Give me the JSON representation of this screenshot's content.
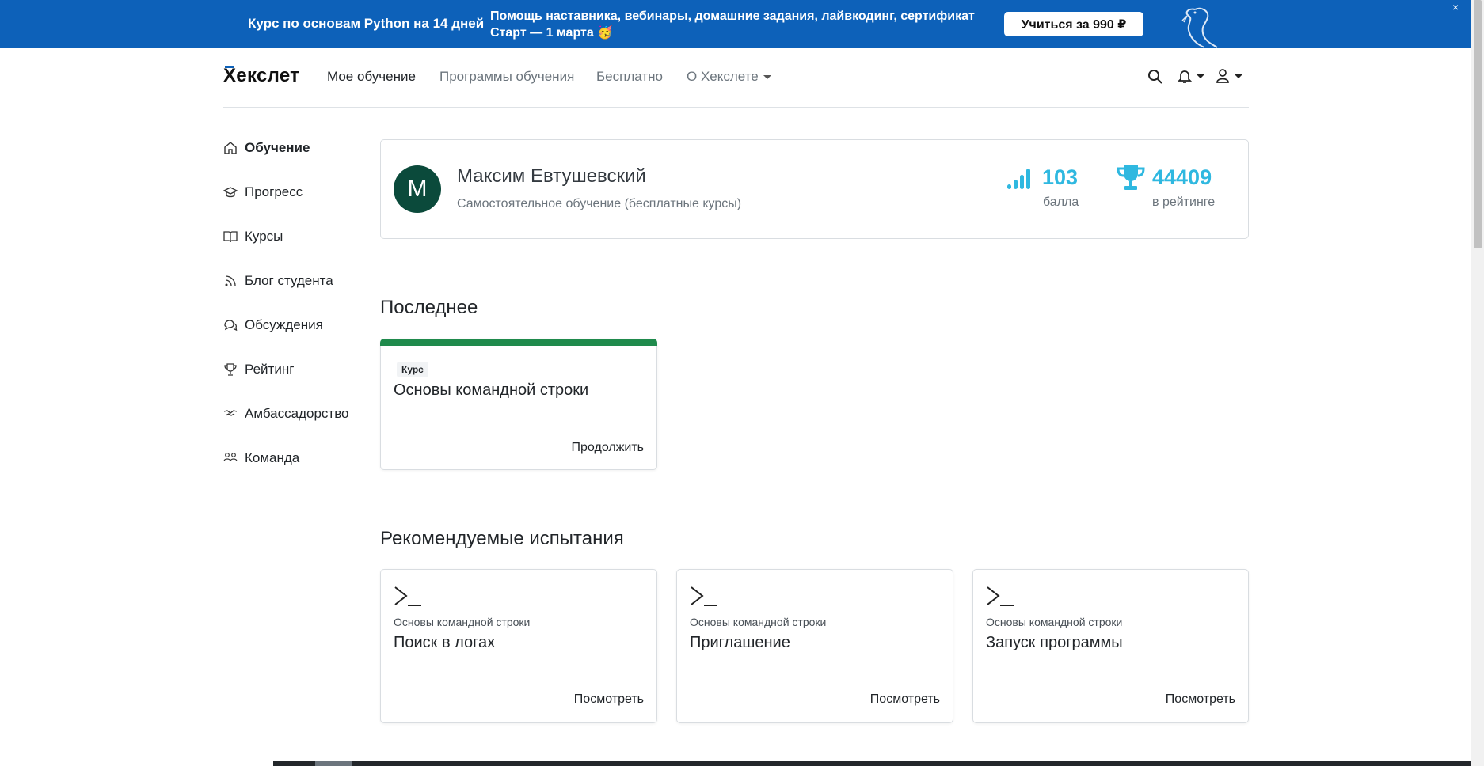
{
  "banner": {
    "course": "Курс по основам Python на 14 дней",
    "desc_line1": "Помощь наставника, вебинары, домашние задания, лайвкодинг, сертификат",
    "desc_line2": "Старт — 1 марта 🥳",
    "cta": "Учиться за 990 ₽",
    "close": "×"
  },
  "header": {
    "logo": "Хекслет",
    "nav": [
      "Мое обучение",
      "Программы обучения",
      "Бесплатно",
      "О Хекслете"
    ]
  },
  "sidebar": {
    "items": [
      {
        "label": "Обучение",
        "icon": "home-icon"
      },
      {
        "label": "Прогресс",
        "icon": "graduation-cap-icon"
      },
      {
        "label": "Курсы",
        "icon": "book-icon"
      },
      {
        "label": "Блог студента",
        "icon": "rss-icon"
      },
      {
        "label": "Обсуждения",
        "icon": "chat-icon"
      },
      {
        "label": "Рейтинг",
        "icon": "trophy-icon"
      },
      {
        "label": "Амбассадорство",
        "icon": "handshake-icon"
      },
      {
        "label": "Команда",
        "icon": "team-icon"
      }
    ]
  },
  "profile": {
    "initial": "M",
    "name": "Максим Евтушевский",
    "subtitle": "Самостоятельное обучение (бесплатные курсы)",
    "points_value": "103",
    "points_label": "балла",
    "rank_value": "44409",
    "rank_label": "в рейтинге"
  },
  "recent": {
    "title": "Последнее",
    "card": {
      "badge": "Курс",
      "title": "Основы командной строки",
      "link": "Продолжить"
    }
  },
  "challenges": {
    "title": "Рекомендуемые испытания",
    "items": [
      {
        "course": "Основы командной строки",
        "title": "Поиск в логах",
        "link": "Посмотреть"
      },
      {
        "course": "Основы командной строки",
        "title": "Приглашение",
        "link": "Посмотреть"
      },
      {
        "course": "Основы командной строки",
        "title": "Запуск программы",
        "link": "Посмотреть"
      }
    ]
  },
  "colors": {
    "banner": "#0d61b9",
    "accent": "#2fb8e0",
    "avatar": "#0b4a3b",
    "course_bar": "#1f8a4c"
  }
}
